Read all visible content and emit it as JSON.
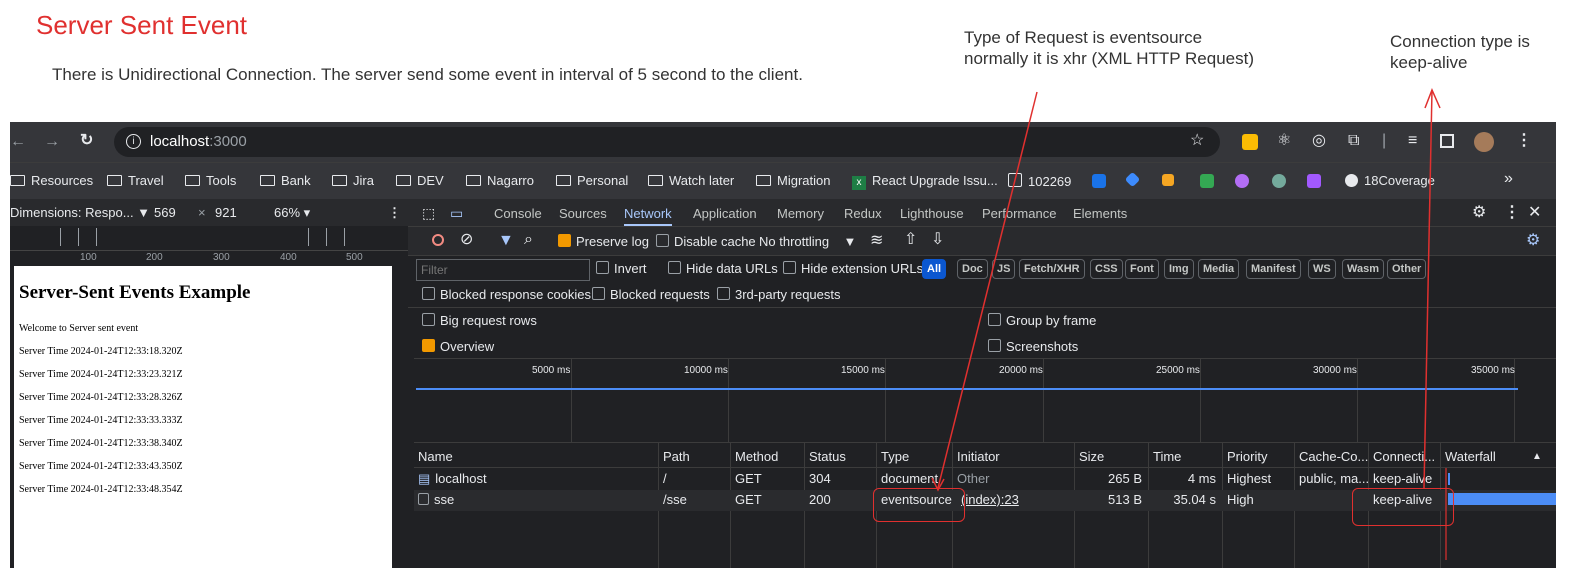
{
  "annotations": {
    "title": "Server Sent Event",
    "subtitle": "There is Unidirectional Connection. The server send some event in interval of 5 second to the client.",
    "note_type": "Type of Request is eventsource\nnormally it is xhr (XML HTTP Request)",
    "note_connection": "Connection type is\nkeep-alive",
    "annotation_color": "#e0302f"
  },
  "browser": {
    "url_host": "localhost",
    "url_port": ":3000",
    "bookmarks": [
      "Resources",
      "Travel",
      "Tools",
      "Bank",
      "Jira",
      "DEV",
      "Nagarro",
      "Personal",
      "Watch later",
      "Migration",
      "React Upgrade Issu...",
      "102269",
      "18Coverage"
    ],
    "more_bookmarks": "»"
  },
  "device_toolbar": {
    "dimensions_label": "Dimensions: Respo... ▼",
    "width": "569",
    "times": "×",
    "height": "921",
    "zoom": "66% ▾",
    "ruler_ticks": [
      "100",
      "200",
      "300",
      "400",
      "500"
    ]
  },
  "page": {
    "heading": "Server-Sent Events Example",
    "lines": [
      "Welcome to Server sent event",
      "Server Time 2024-01-24T12:33:18.320Z",
      "Server Time 2024-01-24T12:33:23.321Z",
      "Server Time 2024-01-24T12:33:28.326Z",
      "Server Time 2024-01-24T12:33:33.333Z",
      "Server Time 2024-01-24T12:33:38.340Z",
      "Server Time 2024-01-24T12:33:43.350Z",
      "Server Time 2024-01-24T12:33:48.354Z"
    ]
  },
  "devtools": {
    "tabs": [
      "Console",
      "Sources",
      "Network",
      "Application",
      "Memory",
      "Redux",
      "Lighthouse",
      "Performance",
      "Elements"
    ],
    "active_tab": "Network",
    "preserve_log": "Preserve log",
    "disable_cache": "Disable cache",
    "throttling": "No throttling",
    "filter_placeholder": "Filter",
    "invert": "Invert",
    "hide_data_urls": "Hide data URLs",
    "hide_extension_urls": "Hide extension URLs",
    "type_filters": [
      "All",
      "Doc",
      "JS",
      "Fetch/XHR",
      "CSS",
      "Font",
      "Img",
      "Media",
      "Manifest",
      "WS",
      "Wasm",
      "Other"
    ],
    "blocked_response_cookies": "Blocked response cookies",
    "blocked_requests": "Blocked requests",
    "third_party_requests": "3rd-party requests",
    "big_request_rows": "Big request rows",
    "group_by_frame": "Group by frame",
    "overview": "Overview",
    "screenshots": "Screenshots",
    "timeline_ticks": [
      "5000 ms",
      "10000 ms",
      "15000 ms",
      "20000 ms",
      "25000 ms",
      "30000 ms",
      "35000 ms"
    ],
    "columns": [
      "Name",
      "Path",
      "Method",
      "Status",
      "Type",
      "Initiator",
      "Size",
      "Time",
      "Priority",
      "Cache-Co...",
      "Connecti...",
      "Waterfall"
    ],
    "rows": [
      {
        "name": "localhost",
        "path": "/",
        "method": "GET",
        "status": "304",
        "type": "document",
        "initiator": "Other",
        "size": "265 B",
        "time": "4 ms",
        "priority": "Highest",
        "cache": "public, ma...",
        "connection": "keep-alive"
      },
      {
        "name": "sse",
        "path": "/sse",
        "method": "GET",
        "status": "200",
        "type": "eventsource",
        "initiator": "(index):23",
        "size": "513 B",
        "time": "35.04 s",
        "priority": "High",
        "cache": "",
        "connection": "keep-alive"
      }
    ]
  }
}
